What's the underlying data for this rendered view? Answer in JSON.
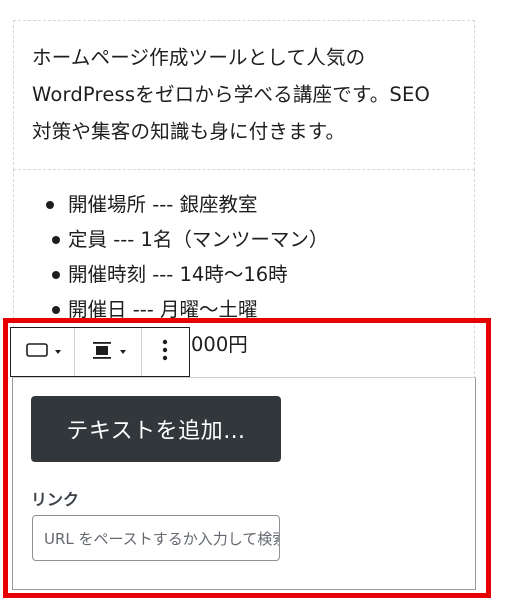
{
  "description": {
    "lines": [
      "ホームページ作成ツールとして人気の",
      "WordPressをゼロから学べる講座です。SEO",
      "対策や集客の知識も身に付きます。"
    ]
  },
  "details": {
    "items": [
      " 開催場所 --- 銀座教室",
      "定員 --- 1名（マンツーマン）",
      "開催時刻 --- 14時～16時",
      "開催日 --- 月曜～土曜",
      "受講料 --- 20,000円"
    ]
  },
  "toolbar": {
    "block_type_icon": "button-block-icon",
    "align_icon": "justify-center-icon",
    "more_icon": "more-vertical-icon"
  },
  "button_block": {
    "text": "テキストを追加…",
    "background_color": "#32373c"
  },
  "link": {
    "label": "リンク",
    "placeholder": "URL をペーストするか入力して検索"
  },
  "colors": {
    "highlight": "#e60000"
  }
}
